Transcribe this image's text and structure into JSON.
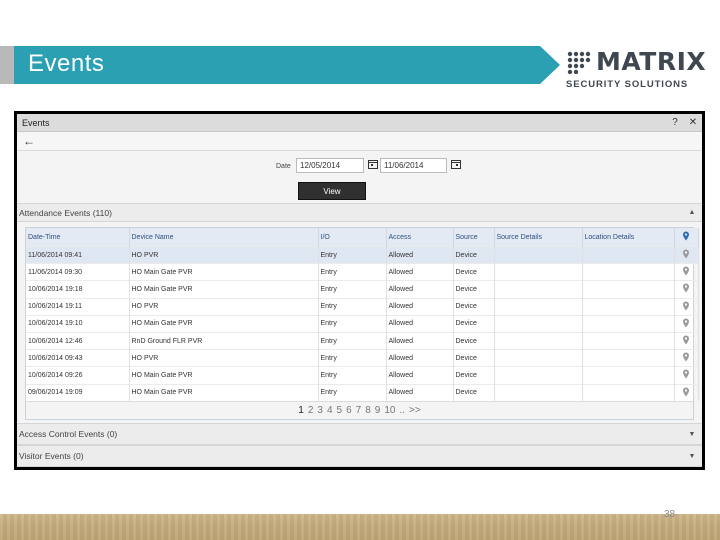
{
  "banner": {
    "title": "Events"
  },
  "logo": {
    "name": "MATRIX",
    "tagline": "SECURITY SOLUTIONS"
  },
  "window": {
    "title": "Events",
    "help_icon": "?",
    "close_icon": "✕",
    "back_icon": "←"
  },
  "filter": {
    "date_label": "Date",
    "from_date": "12/05/2014",
    "to_date": "11/06/2014",
    "view_label": "View"
  },
  "attendance": {
    "header": "Attendance Events (110)",
    "columns": [
      "Date-Time",
      "Device Name",
      "I/O",
      "Access",
      "Source",
      "Source Details",
      "Location Details"
    ],
    "rows": [
      [
        "11/06/2014 09:41",
        "HO PVR",
        "Entry",
        "Allowed",
        "Device",
        "",
        ""
      ],
      [
        "11/06/2014 09:30",
        "HO Main Gate PVR",
        "Entry",
        "Allowed",
        "Device",
        "",
        ""
      ],
      [
        "10/06/2014 19:18",
        "HO Main Gate PVR",
        "Entry",
        "Allowed",
        "Device",
        "",
        ""
      ],
      [
        "10/06/2014 19:11",
        "HO PVR",
        "Entry",
        "Allowed",
        "Device",
        "",
        ""
      ],
      [
        "10/06/2014 19:10",
        "HO Main Gate PVR",
        "Entry",
        "Allowed",
        "Device",
        "",
        ""
      ],
      [
        "10/06/2014 12:46",
        "RnD Ground FLR PVR",
        "Entry",
        "Allowed",
        "Device",
        "",
        ""
      ],
      [
        "10/06/2014 09:43",
        "HO PVR",
        "Entry",
        "Allowed",
        "Device",
        "",
        ""
      ],
      [
        "10/06/2014 09:26",
        "HO Main Gate PVR",
        "Entry",
        "Allowed",
        "Device",
        "",
        ""
      ],
      [
        "09/06/2014 19:09",
        "HO Main Gate PVR",
        "Entry",
        "Allowed",
        "Device",
        "",
        ""
      ]
    ],
    "pages": [
      "1",
      "2",
      "3",
      "4",
      "5",
      "6",
      "7",
      "8",
      "9",
      "10",
      "..",
      ">>"
    ],
    "current_page": "1"
  },
  "access_control": {
    "header": "Access Control Events (0)"
  },
  "visitor": {
    "header": "Visitor Events (0)"
  },
  "slide_number": "38",
  "colors": {
    "banner": "#2ba0b3",
    "header_text": "#2d4f82",
    "selected_row": "#dfe7f2",
    "location_pin": "#2d6bb3"
  },
  "icons": {
    "back": "arrow-left-icon",
    "calendar": "calendar-icon",
    "location": "location-pin-icon"
  }
}
